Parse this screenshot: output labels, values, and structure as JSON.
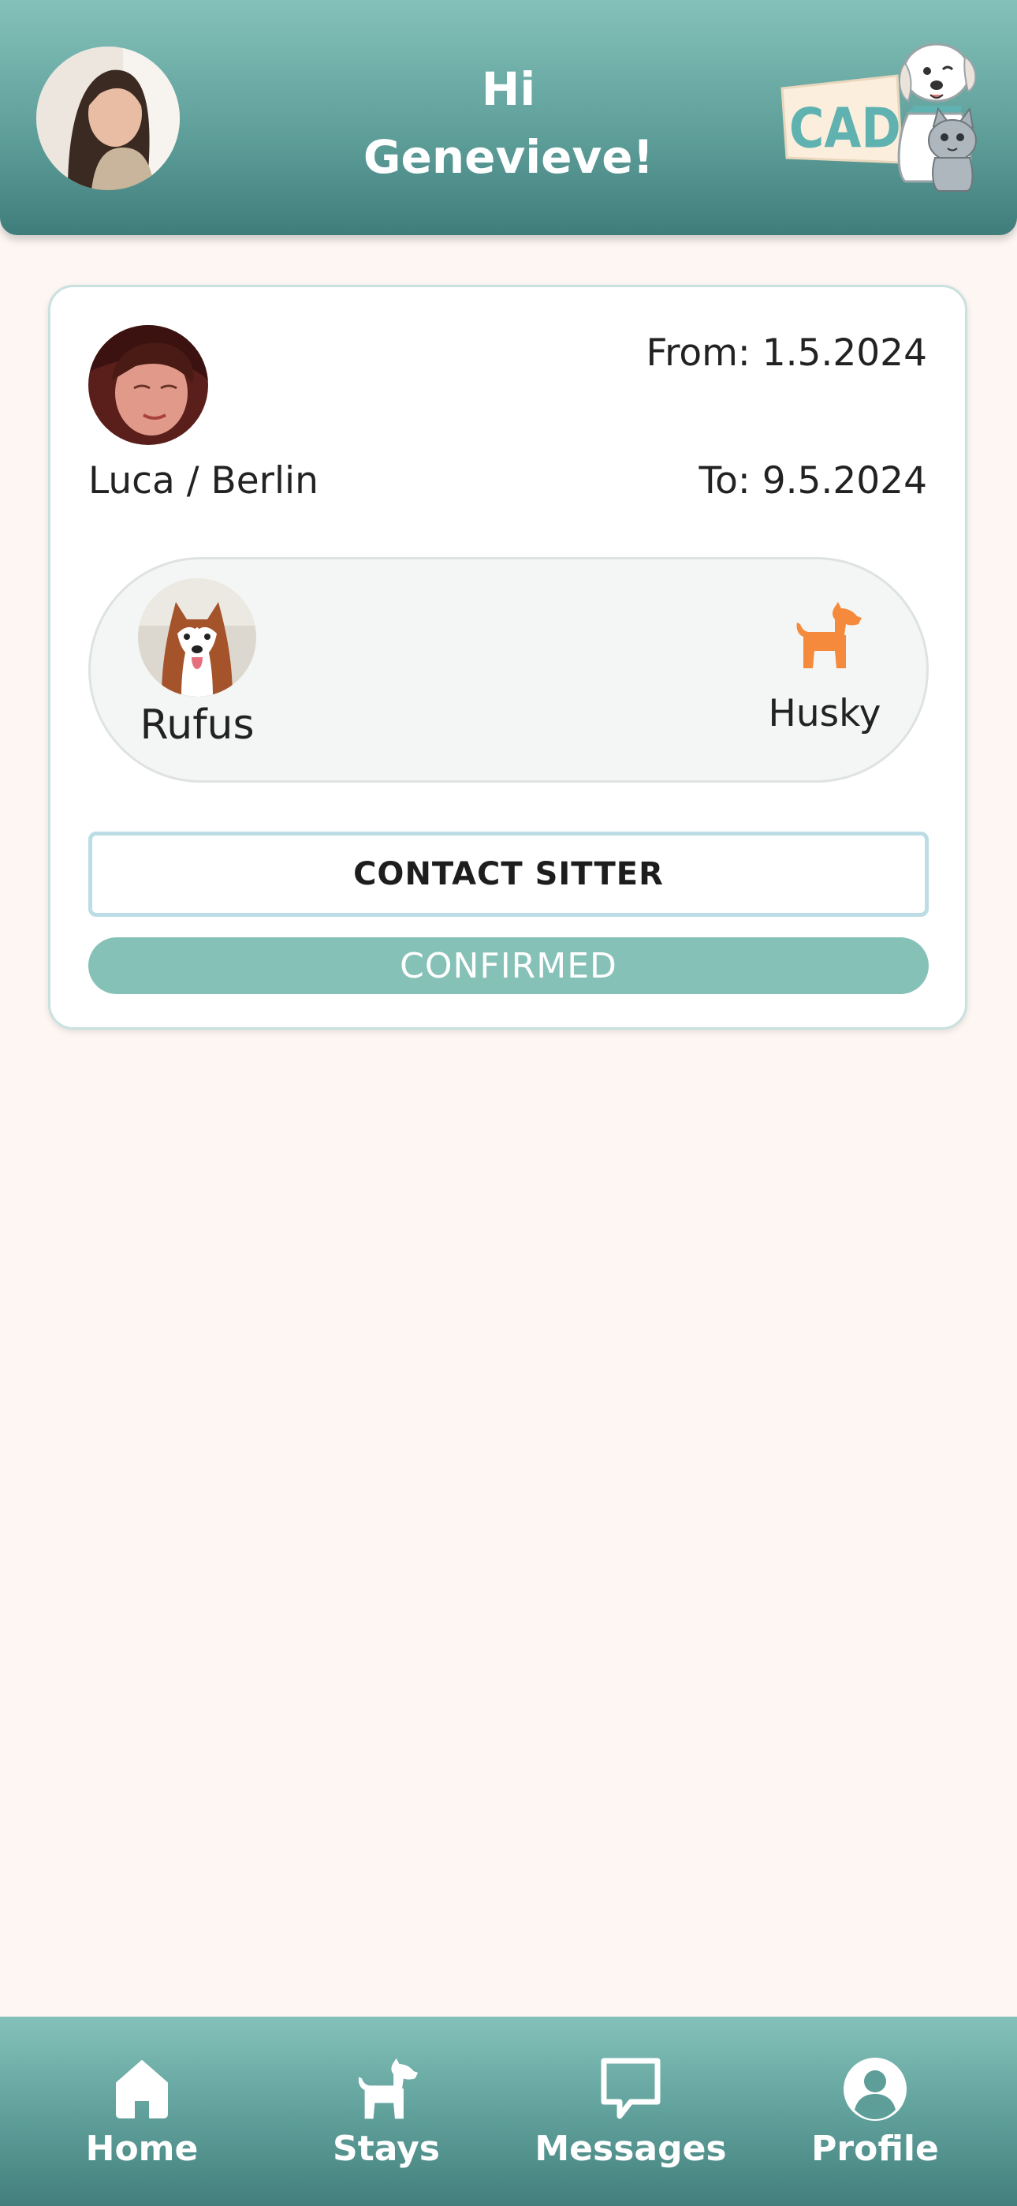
{
  "header": {
    "greeting_line1": "Hi",
    "greeting_line2": "Genevieve!",
    "logo_text": "CADO"
  },
  "booking": {
    "sitter_name": "Luca / Berlin",
    "from": "From: 1.5.2024",
    "to": "To: 9.5.2024",
    "pet": {
      "name": "Rufus",
      "breed": "Husky",
      "type_icon": "dog-icon"
    },
    "contact_label": "CONTACT SITTER",
    "status": "CONFIRMED"
  },
  "nav": {
    "items": [
      {
        "label": "Home",
        "icon": "home-icon"
      },
      {
        "label": "Stays",
        "icon": "dog-icon"
      },
      {
        "label": "Messages",
        "icon": "chat-bubble-icon"
      },
      {
        "label": "Profile",
        "icon": "user-circle-icon"
      }
    ]
  },
  "colors": {
    "header_top": "#84c1ba",
    "header_bottom": "#3f7d7b",
    "background": "#fdf6f2",
    "status_badge": "#86c1b7",
    "breed_icon": "#f58a3d",
    "contact_border": "#bcdde6"
  }
}
